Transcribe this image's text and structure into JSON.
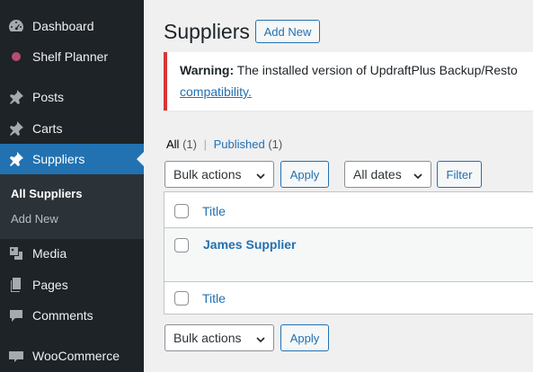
{
  "sidebar": {
    "items": [
      {
        "label": "Dashboard",
        "icon": "dashboard-icon"
      },
      {
        "label": "Shelf Planner",
        "icon": "shelf-planner-icon"
      },
      {
        "label": "Posts",
        "icon": "pin-icon"
      },
      {
        "label": "Carts",
        "icon": "pin-icon"
      },
      {
        "label": "Suppliers",
        "icon": "pin-icon",
        "active": true
      },
      {
        "label": "Media",
        "icon": "media-icon"
      },
      {
        "label": "Pages",
        "icon": "pages-icon"
      },
      {
        "label": "Comments",
        "icon": "comments-icon"
      },
      {
        "label": "WooCommerce",
        "icon": "woocommerce-icon"
      }
    ],
    "submenu": {
      "current": "All Suppliers",
      "other": "Add New"
    }
  },
  "page": {
    "title": "Suppliers",
    "add_new": "Add New"
  },
  "notice": {
    "warning_label": "Warning:",
    "text": " The installed version of UpdraftPlus Backup/Resto",
    "link": "compatibility."
  },
  "views": {
    "all_label": "All",
    "all_count": "(1)",
    "separator": "|",
    "published_label": "Published",
    "published_count": "(1)"
  },
  "filters": {
    "bulk_actions": "Bulk actions",
    "apply": "Apply",
    "dates": "All dates",
    "filter": "Filter"
  },
  "table": {
    "header_title": "Title",
    "rows": [
      {
        "title": "James Supplier"
      }
    ],
    "footer_title": "Title"
  },
  "bottom": {
    "bulk_actions": "Bulk actions",
    "apply": "Apply"
  },
  "colors": {
    "accent": "#2271b1",
    "sidebar_bg": "#1d2327",
    "notice_border": "#d63638",
    "shelf_planner_dot": "#b64d6f"
  }
}
